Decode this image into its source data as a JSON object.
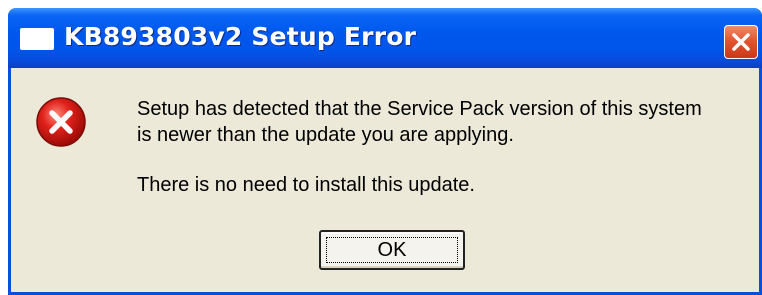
{
  "window": {
    "title": "KB893803v2 Setup Error",
    "icon": "window-icon",
    "close_icon": "close-icon",
    "accent_color": "#0058ee",
    "close_color": "#e2552f",
    "body_color": "#ece9d8"
  },
  "message": {
    "icon": "error-icon",
    "line1": "Setup has detected that the Service Pack version of this system",
    "line2": "is newer than the update you are applying.",
    "line3": "There is no need to install this update."
  },
  "buttons": {
    "ok_label": "OK"
  }
}
